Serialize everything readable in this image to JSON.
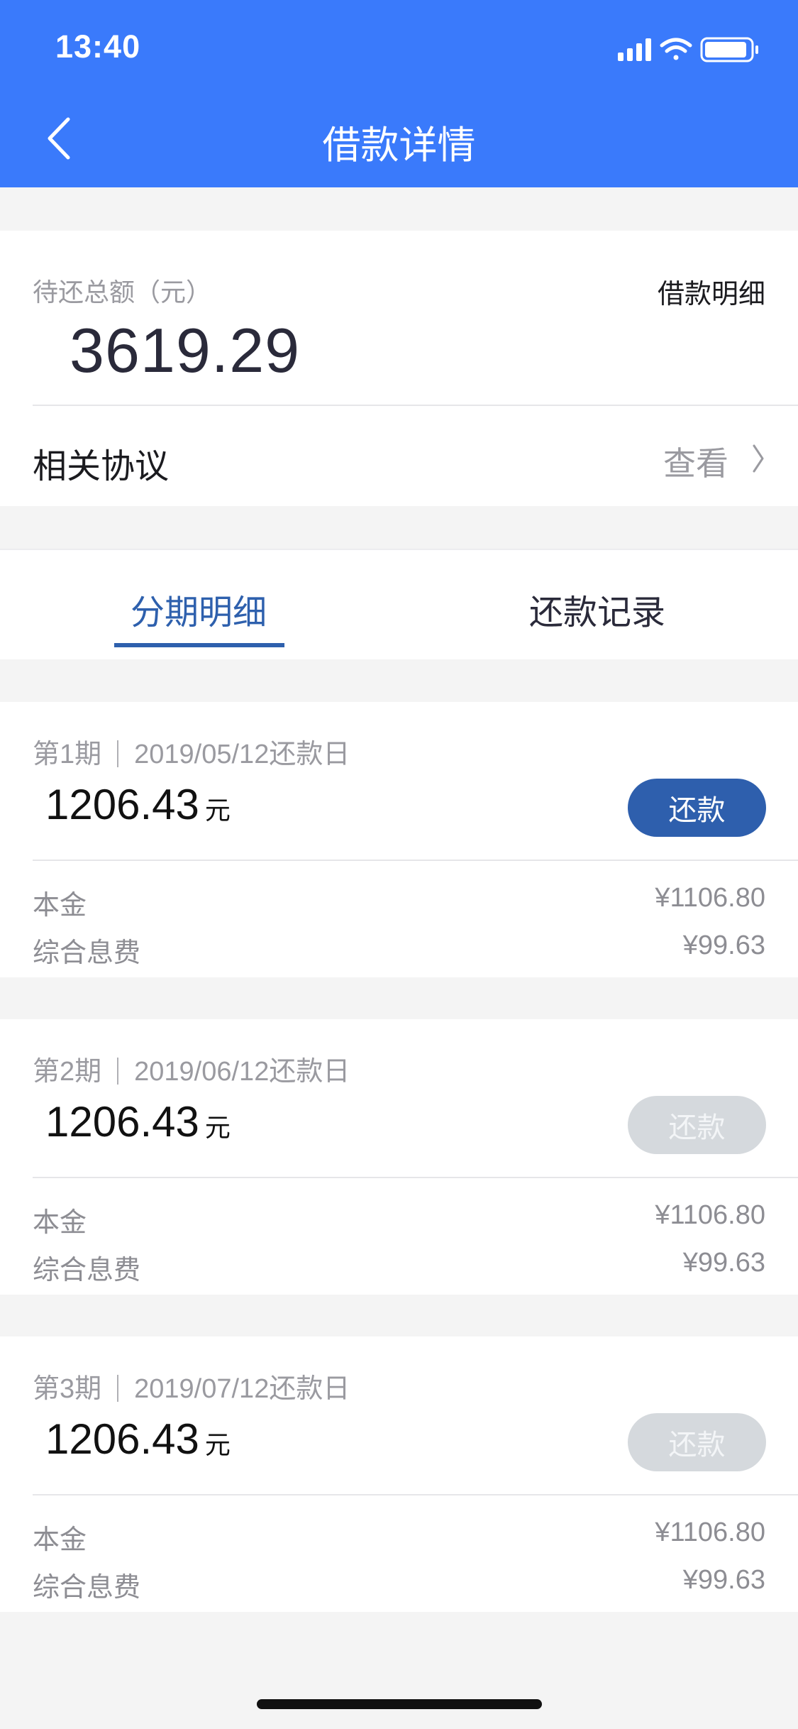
{
  "status_bar": {
    "time": "13:40"
  },
  "nav": {
    "title": "借款详情"
  },
  "summary": {
    "label": "待还总额（元）",
    "detail_link": "借款明细",
    "amount": "3619.29",
    "agreement_label": "相关协议",
    "agreement_view": "查看"
  },
  "tabs": [
    {
      "label": "分期明细",
      "active": true
    },
    {
      "label": "还款记录",
      "active": false
    }
  ],
  "installments": [
    {
      "period": "第1期",
      "due": "2019/05/12还款日",
      "amount": "1206.43",
      "unit": "元",
      "button": "还款",
      "button_enabled": true,
      "principal_label": "本金",
      "principal": "¥1106.80",
      "fee_label": "综合息费",
      "fee": "¥99.63"
    },
    {
      "period": "第2期",
      "due": "2019/06/12还款日",
      "amount": "1206.43",
      "unit": "元",
      "button": "还款",
      "button_enabled": false,
      "principal_label": "本金",
      "principal": "¥1106.80",
      "fee_label": "综合息费",
      "fee": "¥99.63"
    },
    {
      "period": "第3期",
      "due": "2019/07/12还款日",
      "amount": "1206.43",
      "unit": "元",
      "button": "还款",
      "button_enabled": false,
      "principal_label": "本金",
      "principal": "¥1106.80",
      "fee_label": "综合息费",
      "fee": "¥99.63"
    }
  ],
  "colors": {
    "header": "#3a7afb",
    "accent": "#2e60ad",
    "disabled_button": "#d5d9dd"
  },
  "icons": {
    "back": "chevron-left-icon",
    "chevron": "chevron-right-icon",
    "signal": "signal-icon",
    "wifi": "wifi-icon",
    "battery": "battery-icon"
  }
}
